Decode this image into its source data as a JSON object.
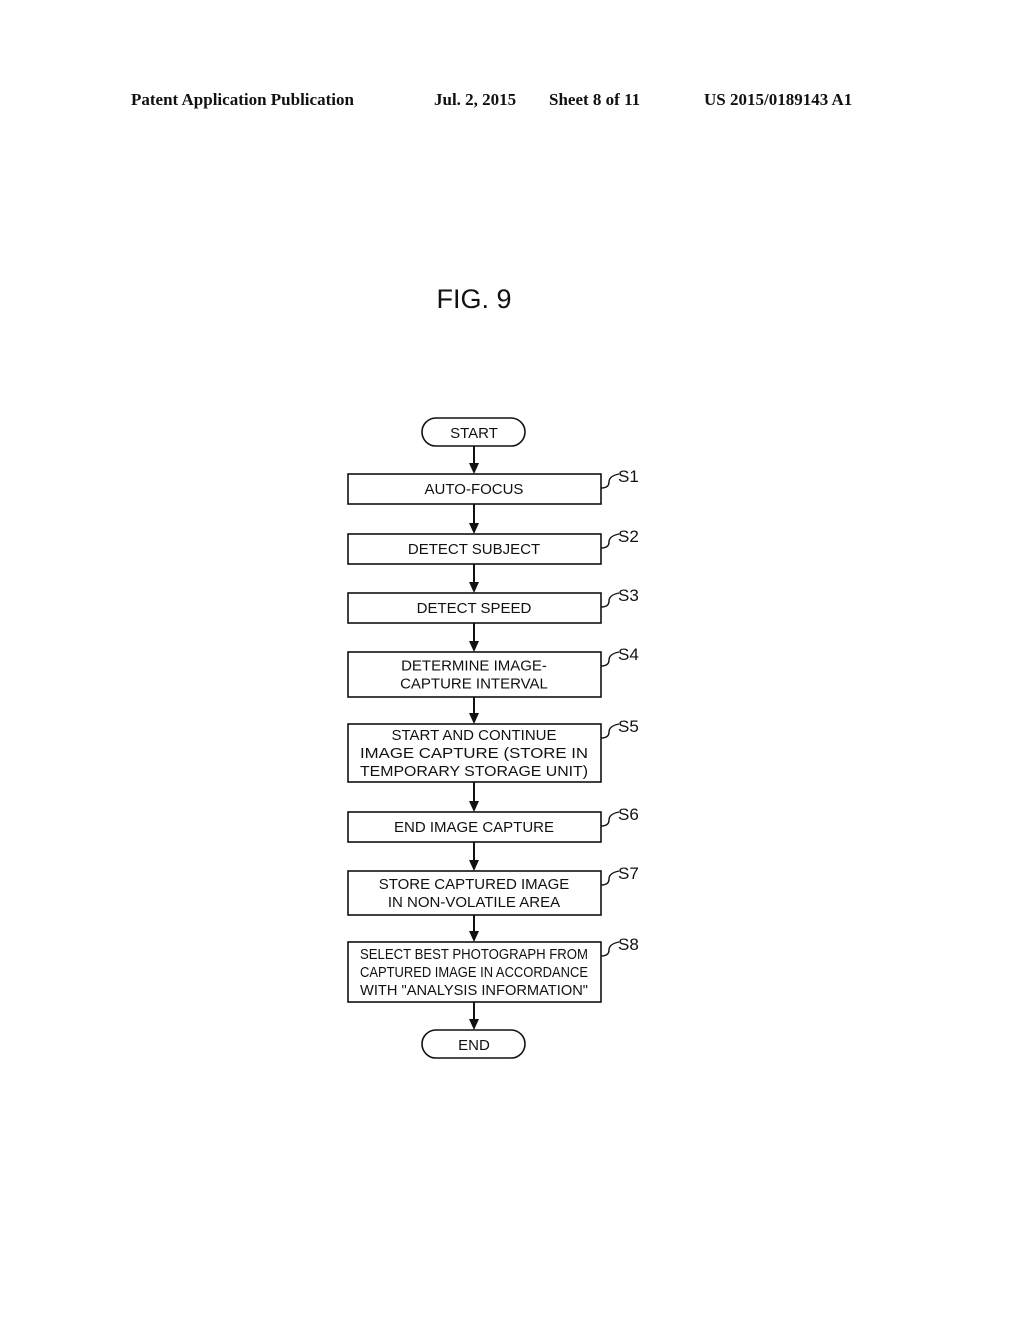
{
  "header": {
    "publication": "Patent Application Publication",
    "date": "Jul. 2, 2015",
    "sheet": "Sheet 8 of 11",
    "number": "US 2015/0189143 A1"
  },
  "figure": {
    "title": "FIG. 9"
  },
  "flowchart": {
    "start": "START",
    "end": "END",
    "steps": [
      {
        "id": "S1",
        "lines": [
          "AUTO-FOCUS"
        ]
      },
      {
        "id": "S2",
        "lines": [
          "DETECT SUBJECT"
        ]
      },
      {
        "id": "S3",
        "lines": [
          "DETECT SPEED"
        ]
      },
      {
        "id": "S4",
        "lines": [
          "DETERMINE IMAGE-",
          "CAPTURE INTERVAL"
        ]
      },
      {
        "id": "S5",
        "lines": [
          "START AND CONTINUE",
          "IMAGE CAPTURE (STORE IN",
          "TEMPORARY STORAGE UNIT)"
        ]
      },
      {
        "id": "S6",
        "lines": [
          "END IMAGE CAPTURE"
        ]
      },
      {
        "id": "S7",
        "lines": [
          "STORE CAPTURED IMAGE",
          "IN NON-VOLATILE AREA"
        ]
      },
      {
        "id": "S8",
        "lines": [
          "SELECT BEST PHOTOGRAPH FROM",
          "CAPTURED IMAGE IN ACCORDANCE",
          "WITH \"ANALYSIS INFORMATION\""
        ]
      }
    ]
  }
}
